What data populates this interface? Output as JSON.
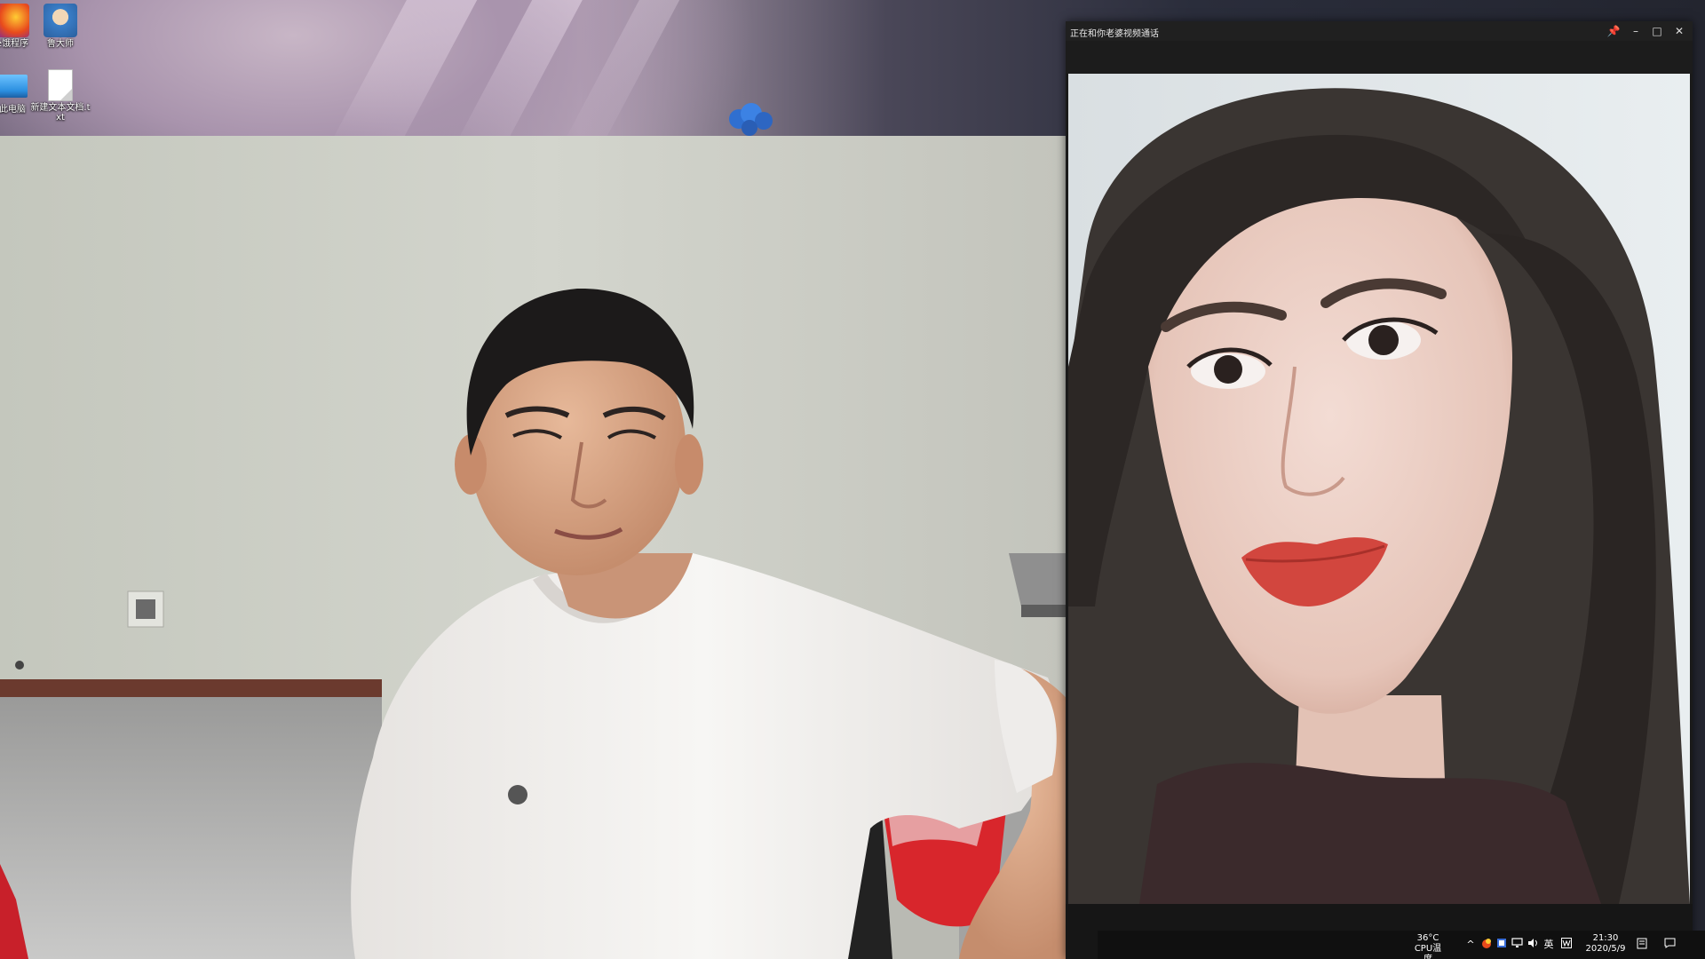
{
  "desktop": {
    "icons": [
      {
        "label": "e饿程序"
      },
      {
        "label": "鲁大师"
      },
      {
        "label": "此电脑"
      },
      {
        "label": "新建文本文档.txt"
      }
    ]
  },
  "call_window": {
    "title": "正在和你老婆视频通话",
    "buttons": {
      "pin": "📌",
      "minimize": "–",
      "maximize": "□",
      "close": "✕"
    }
  },
  "taskbar": {
    "cpu_temp": "36°C",
    "cpu_label": "CPU温度",
    "ime": "英",
    "time": "21:30",
    "date": "2020/5/9",
    "tray_chevron": "^"
  },
  "colors": {
    "call_bg": "#1a1a1a",
    "titlebar_bg": "#202020",
    "taskbar_bg": "#101010",
    "wall_color": "#cfd1c8",
    "shirt_color": "#f4f2f0",
    "chair_red": "#d8262c"
  }
}
